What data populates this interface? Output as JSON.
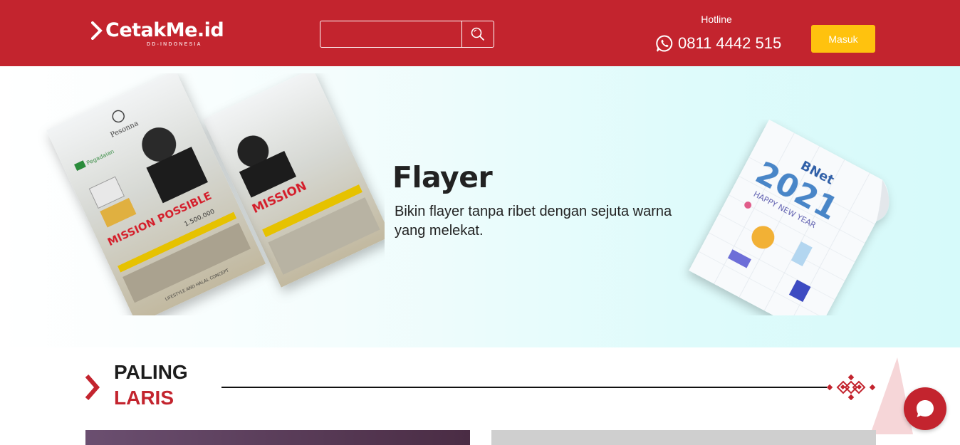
{
  "header": {
    "logo_text": "CetakMe.id",
    "logo_sub": "DD-INDONESIA",
    "search": {
      "value": "",
      "placeholder": ""
    },
    "hotline_label": "Hotline",
    "hotline_number": "0811 4442 515",
    "login_label": "Masuk"
  },
  "hero": {
    "title": "Flayer",
    "description": "Bikin flayer tanpa ribet dengan sejuta warna yang melekat.",
    "left_poster": {
      "brand": "Pesonna",
      "partner": "Pegadaian",
      "headline": "MISSION POSSIBLE",
      "price": "1.500.000",
      "footer": "LIFESTYLE AND HALAL CONCEPT"
    },
    "right_poster": {
      "brand": "BNet",
      "year": "2021",
      "greeting": "HAPPY NEW YEAR"
    }
  },
  "section": {
    "title_line1": "PALING",
    "title_line2": "LARIS"
  },
  "colors": {
    "brand_red": "#c3242e",
    "login_yellow": "#ffc20e",
    "hero_teal": "#d6fafa"
  },
  "icons": {
    "search": "search-icon",
    "whatsapp": "whatsapp-icon",
    "chat": "chat-bubble-icon"
  }
}
